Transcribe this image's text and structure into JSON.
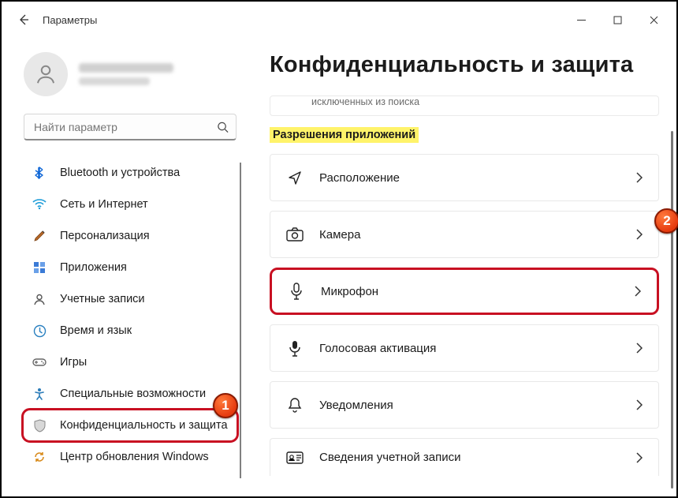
{
  "window": {
    "title": "Параметры"
  },
  "search": {
    "placeholder": "Найти параметр"
  },
  "sidebar": {
    "items": [
      {
        "label": "Bluetooth и устройства"
      },
      {
        "label": "Сеть и Интернет"
      },
      {
        "label": "Персонализация"
      },
      {
        "label": "Приложения"
      },
      {
        "label": "Учетные записи"
      },
      {
        "label": "Время и язык"
      },
      {
        "label": "Игры"
      },
      {
        "label": "Специальные возможности"
      },
      {
        "label": "Конфиденциальность и защита"
      },
      {
        "label": "Центр обновления Windows"
      }
    ]
  },
  "page": {
    "title": "Конфиденциальность и защита",
    "partial_row": "исключенных из поиска",
    "section": "Разрешения приложений",
    "cards": [
      {
        "label": "Расположение"
      },
      {
        "label": "Камера"
      },
      {
        "label": "Микрофон"
      },
      {
        "label": "Голосовая активация"
      },
      {
        "label": "Уведомления"
      },
      {
        "label": "Сведения учетной записи"
      }
    ]
  },
  "annotations": {
    "badge1": "1",
    "badge2": "2"
  }
}
